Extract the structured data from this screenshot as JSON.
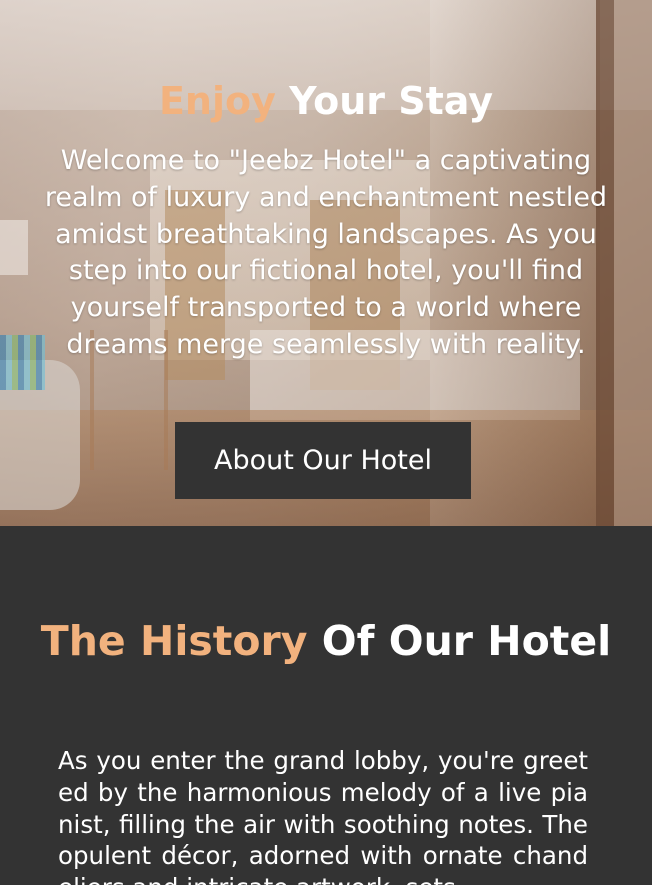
{
  "hero": {
    "title_accent": "Enjoy",
    "title_rest": " Your Stay",
    "description": "Welcome to \"Jeebz Hotel\" a captivating realm of luxury and enchantment nestled amidst breathtaking landscapes. As you step into our fictional hotel, you'll find yourself transported to a world where dreams merge seamlessly with reality.",
    "button_label": "About Our Hotel"
  },
  "history": {
    "title_accent": "The History",
    "title_rest": " Of Our Hotel",
    "text": "As you enter the grand lobby, you're greeted by the harmonious melody of a live pianist, filling the air with soothing notes. The opulent décor, adorned with ornate chandeliers and intricate artwork, sets"
  },
  "colors": {
    "accent": "#f2b27e",
    "dark_background": "#333333",
    "text": "#ffffff"
  }
}
